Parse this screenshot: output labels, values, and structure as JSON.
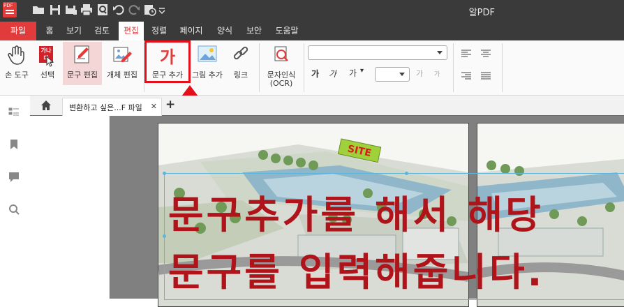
{
  "window": {
    "title": "알PDF"
  },
  "menu": {
    "items": [
      {
        "label": "파일"
      },
      {
        "label": "홈"
      },
      {
        "label": "보기"
      },
      {
        "label": "검토"
      },
      {
        "label": "편집"
      },
      {
        "label": "정렬"
      },
      {
        "label": "페이지"
      },
      {
        "label": "양식"
      },
      {
        "label": "보안"
      },
      {
        "label": "도움말"
      }
    ],
    "active": "편집"
  },
  "ribbon": {
    "hand_tool": "손 도구",
    "select": "선택",
    "select_badge": "가나다",
    "edit_text": "문구 편집",
    "edit_object": "개체 편집",
    "add_text": "문구 추가",
    "add_text_glyph": "가",
    "add_image": "그림 추가",
    "link": "링크",
    "ocr_line1": "문자인식",
    "ocr_line2": "(OCR)",
    "bold_glyph": "가",
    "italic_glyph": "가",
    "size_glyph": "가",
    "grow_glyph": "가",
    "shrink_glyph": "가",
    "font_name": "",
    "font_size": ""
  },
  "tabs": {
    "doc_tab_label": "변환하고 싶은...F 파일",
    "close": "✕",
    "add": "+"
  },
  "document": {
    "site_label": "SITE",
    "overlay_line1": "문구추가를 해서 해당",
    "overlay_line2": "문구를 입력해줍니다."
  }
}
